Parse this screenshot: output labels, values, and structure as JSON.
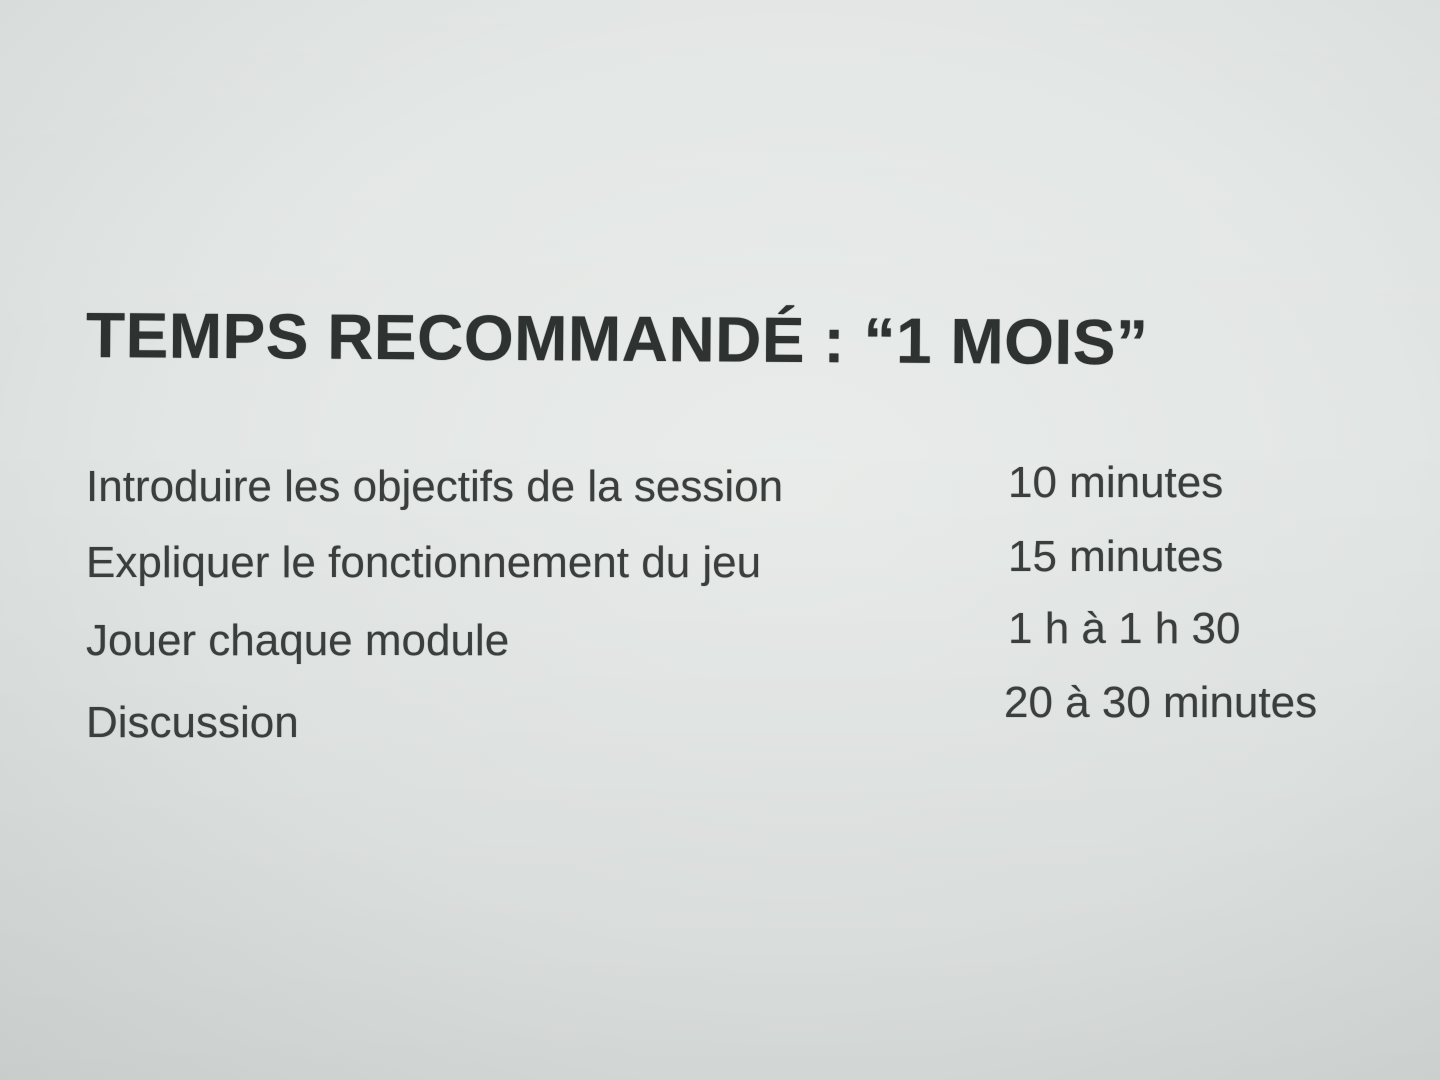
{
  "document": {
    "heading": "TEMPS RECOMMANDÉ : “1 MOIS”",
    "schedule": [
      {
        "activity": "Introduire les objectifs de la session",
        "duration": "10 minutes"
      },
      {
        "activity": "Expliquer le fonctionnement du jeu",
        "duration": "15 minutes"
      },
      {
        "activity": "Jouer chaque module",
        "duration": "1 h à 1 h 30"
      },
      {
        "activity": "Discussion",
        "duration": "20 à 30 minutes"
      }
    ]
  },
  "colors": {
    "paper": "#e2e6e4",
    "ink": "#2e3231"
  }
}
